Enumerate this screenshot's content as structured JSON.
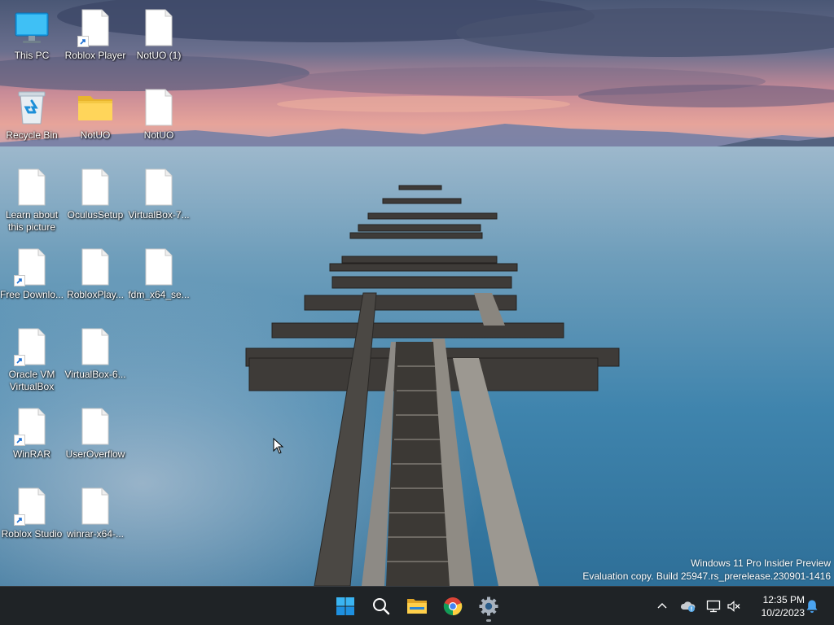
{
  "desktop": {
    "icons": [
      {
        "label": "This PC",
        "icon": "computer-icon"
      },
      {
        "label": "Roblox Player",
        "icon": "file-icon",
        "shortcut": true
      },
      {
        "label": "NotUO (1)",
        "icon": "file-icon"
      },
      {
        "label": "Recycle Bin",
        "icon": "recycle-bin-icon"
      },
      {
        "label": "NotUO",
        "icon": "folder-icon"
      },
      {
        "label": "NotUO",
        "icon": "file-icon"
      },
      {
        "label": "Learn about this picture",
        "icon": "file-icon"
      },
      {
        "label": "OculusSetup",
        "icon": "file-icon"
      },
      {
        "label": "VirtualBox-7...",
        "icon": "file-icon"
      },
      {
        "label": "Free Downlo...",
        "icon": "file-icon",
        "shortcut": true
      },
      {
        "label": "RobloxPlay...",
        "icon": "file-icon"
      },
      {
        "label": "fdm_x64_se...",
        "icon": "file-icon"
      },
      {
        "label": "Oracle VM VirtualBox",
        "icon": "file-icon",
        "shortcut": true
      },
      {
        "label": "VirtualBox-6...",
        "icon": "file-icon"
      },
      {
        "label": "WinRAR",
        "icon": "file-icon",
        "shortcut": true
      },
      {
        "label": "UserOverflow",
        "icon": "file-icon"
      },
      {
        "label": "Roblox Studio",
        "icon": "file-icon",
        "shortcut": true
      },
      {
        "label": "winrar-x64-...",
        "icon": "file-icon"
      }
    ]
  },
  "watermark": {
    "line1": "Windows 11 Pro Insider Preview",
    "line2": "Evaluation copy. Build 25947.rs_prerelease.230901-1416"
  },
  "taskbar": {
    "apps": [
      {
        "name": "start",
        "icon": "windows-logo-icon"
      },
      {
        "name": "search",
        "icon": "search-icon"
      },
      {
        "name": "file-explorer",
        "icon": "folder-icon"
      },
      {
        "name": "chrome",
        "icon": "chrome-icon"
      },
      {
        "name": "settings",
        "icon": "gear-icon",
        "running": true
      }
    ],
    "tray": [
      "chevron-up-icon",
      "onedrive-icon",
      "network-icon",
      "volume-muted-icon"
    ],
    "clock": {
      "time": "12:35 PM",
      "date": "10/2/2023"
    },
    "notification": "bell-icon"
  },
  "colors": {
    "taskbar": "#1f2326",
    "accent": "#0078d4",
    "water": "#3b7fa4"
  }
}
